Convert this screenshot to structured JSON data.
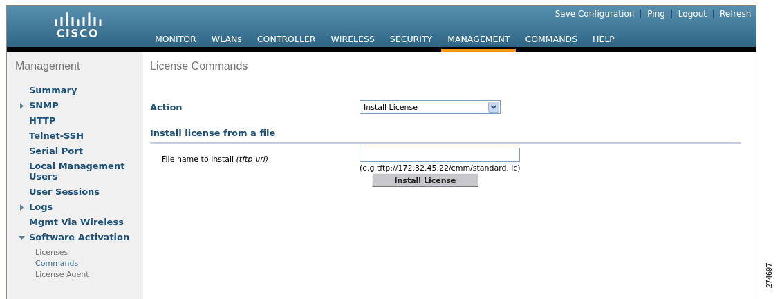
{
  "header": {
    "logo": "CISCO",
    "top_links": [
      "Save Configuration",
      "Ping",
      "Logout",
      "Refresh"
    ],
    "nav": [
      {
        "label": "MONITOR",
        "selected": false
      },
      {
        "label": "WLANs",
        "selected": false
      },
      {
        "label": "CONTROLLER",
        "selected": false
      },
      {
        "label": "WIRELESS",
        "selected": false
      },
      {
        "label": "SECURITY",
        "selected": false
      },
      {
        "label": "MANAGEMENT",
        "selected": true
      },
      {
        "label": "COMMANDS",
        "selected": false
      },
      {
        "label": "HELP",
        "selected": false
      }
    ]
  },
  "sidebar": {
    "title": "Management",
    "items": [
      {
        "label": "Summary",
        "kind": "page"
      },
      {
        "label": "SNMP",
        "kind": "folder",
        "expanded": false
      },
      {
        "label": "HTTP",
        "kind": "page"
      },
      {
        "label": "Telnet-SSH",
        "kind": "page"
      },
      {
        "label": "Serial Port",
        "kind": "page"
      },
      {
        "label": "Local Management Users",
        "kind": "page"
      },
      {
        "label": "User Sessions",
        "kind": "page"
      },
      {
        "label": "Logs",
        "kind": "folder",
        "expanded": false
      },
      {
        "label": "Mgmt Via Wireless",
        "kind": "page"
      },
      {
        "label": "Software Activation",
        "kind": "folder",
        "expanded": true,
        "children": [
          {
            "label": "Licenses",
            "selected": false
          },
          {
            "label": "Commands",
            "selected": true
          },
          {
            "label": "License Agent",
            "selected": false
          }
        ]
      }
    ]
  },
  "content": {
    "title": "License Commands",
    "action": {
      "label": "Action",
      "value": "Install License"
    },
    "section": {
      "heading": "Install license from a file",
      "field_label": "File name to install *(tftp-url)*",
      "hint": "(e.g tftp://172.32.45.22/cmm/standard.lic)",
      "button": "Install License"
    }
  },
  "figure_number": "274697"
}
